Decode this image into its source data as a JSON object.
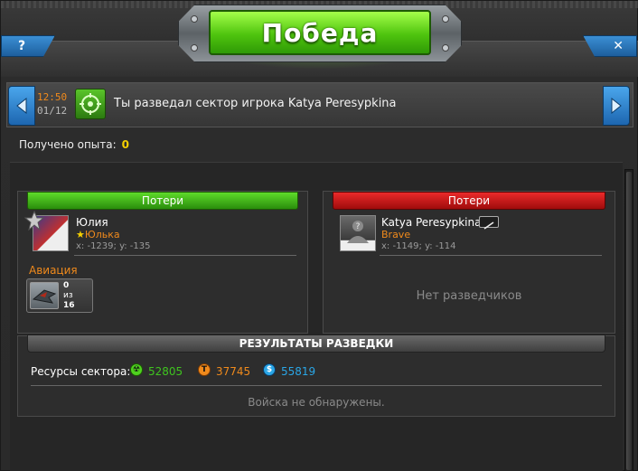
{
  "dialog": {
    "title": "Победа",
    "help_label": "?",
    "close_label": "✕"
  },
  "message": {
    "time": "12:50",
    "date": "01/12",
    "text": "Ты разведал сектор игрока Katya Peresypkina",
    "prev_icon": "arrow-left-icon",
    "next_icon": "arrow-right-icon"
  },
  "experience": {
    "label": "Получено опыта:",
    "value": "0"
  },
  "attacker": {
    "header": "Потери",
    "name": "Юлия",
    "alliance": "Юлька",
    "coords": "x: -1239; y: -135",
    "section_label": "Авиация",
    "unit": {
      "count": "0",
      "of_label": "из",
      "total": "16"
    },
    "header_color": "#3fb81a"
  },
  "defender": {
    "header": "Потери",
    "name": "Katya Peresypkina",
    "alliance": "Brave",
    "coords": "x: -1149; y: -114",
    "empty_text": "Нет разведчиков",
    "header_color": "#d11a1a"
  },
  "results": {
    "header": "РЕЗУЛЬТАТЫ РАЗВЕДКИ",
    "resources_label": "Ресурсы сектора:",
    "resources": [
      {
        "icon": "uranium-icon",
        "value": "52805",
        "color": "#3fc41f"
      },
      {
        "icon": "titanium-icon",
        "value": "37745",
        "color": "#f08a1c"
      },
      {
        "icon": "credits-icon",
        "value": "55819",
        "color": "#2aa6e6"
      }
    ],
    "no_troops_text": "Войска не обнаружены."
  }
}
